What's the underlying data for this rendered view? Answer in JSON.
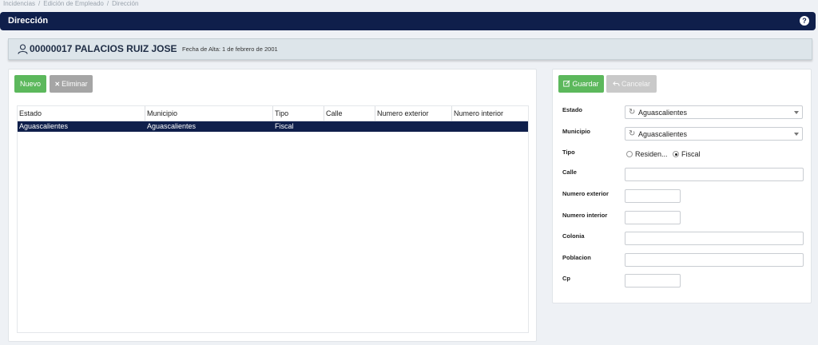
{
  "breadcrumb": {
    "items": [
      "Incidencias",
      "Edición de Empleado",
      "Dirección"
    ]
  },
  "header": {
    "title": "Dirección",
    "help_icon": "question-circle-icon",
    "help_glyph": "?"
  },
  "employee": {
    "name": "00000017 PALACIOS RUIZ JOSE",
    "fecha_alta": "Fecha de Alta: 1 de febrero de 2001",
    "icon": "user-icon"
  },
  "toolbar": {
    "nuevo_label": "Nuevo",
    "eliminar_label": "Eliminar",
    "eliminar_glyph": "✕"
  },
  "table": {
    "columns": [
      "Estado",
      "Municipio",
      "Tipo",
      "Calle",
      "Numero exterior",
      "Numero interior"
    ],
    "rows": [
      {
        "estado": "Aguascalientes",
        "municipio": "Aguascalientes",
        "tipo": "Fiscal",
        "calle": "",
        "numero_exterior": "",
        "numero_interior": ""
      }
    ]
  },
  "form": {
    "guardar_label": "Guardar",
    "cancelar_label": "Cancelar",
    "estado_label": "Estado",
    "estado_value": "Aguascalientes",
    "municipio_label": "Municipio",
    "municipio_value": "Aguascalientes",
    "tipo_label": "Tipo",
    "tipo_options": [
      "Residen...",
      "Fiscal"
    ],
    "tipo_selected": "Fiscal",
    "calle_label": "Calle",
    "calle_value": "",
    "numero_exterior_label": "Numero exterior",
    "numero_exterior_value": "",
    "numero_interior_label": "Numero interior",
    "numero_interior_value": "",
    "colonia_label": "Colonia",
    "colonia_value": "",
    "poblacion_label": "Poblacion",
    "poblacion_value": "",
    "cp_label": "Cp",
    "cp_value": ""
  },
  "colors": {
    "header_bg": "#0f1f4b",
    "selected_row_bg": "#0f1f4b",
    "primary_green": "#5cb85c",
    "button_gray": "#a5a5a5",
    "page_bg": "#eef1f5"
  }
}
